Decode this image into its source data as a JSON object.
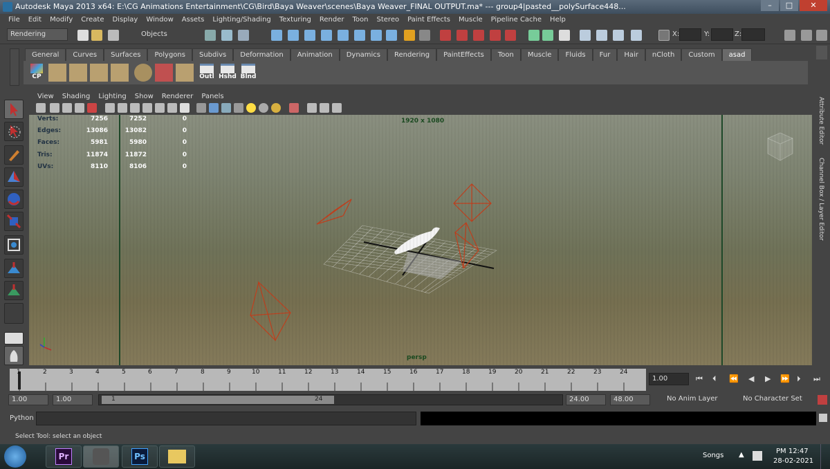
{
  "window": {
    "title": "Autodesk Maya 2013 x64: E:\\CG Animations Entertainment\\CG\\Bird\\Baya Weaver\\scenes\\Baya Weaver_FINAL OUTPUT.ma*   ---   group4|pasted__polySurface448..."
  },
  "menu": [
    "File",
    "Edit",
    "Modify",
    "Create",
    "Display",
    "Window",
    "Assets",
    "Lighting/Shading",
    "Texturing",
    "Render",
    "Toon",
    "Stereo",
    "Paint Effects",
    "Muscle",
    "Pipeline Cache",
    "Help"
  ],
  "statusline": {
    "menuset": "Rendering",
    "selection_mode": "Objects",
    "x_label": "X:",
    "y_label": "Y:",
    "z_label": "Z:"
  },
  "shelf_tabs": [
    "General",
    "Curves",
    "Surfaces",
    "Polygons",
    "Subdivs",
    "Deformation",
    "Animation",
    "Dynamics",
    "Rendering",
    "PaintEffects",
    "Toon",
    "Muscle",
    "Fluids",
    "Fur",
    "Hair",
    "nCloth",
    "Custom",
    "asad"
  ],
  "shelf_labels": {
    "cp": "CP",
    "outl": "Outl",
    "hshd": "Hshd",
    "blnd": "Blnd"
  },
  "panel_menu": [
    "View",
    "Shading",
    "Lighting",
    "Show",
    "Renderer",
    "Panels"
  ],
  "hud": {
    "rows": [
      {
        "label": "Verts:",
        "a": "7256",
        "b": "7252",
        "c": "0"
      },
      {
        "label": "Edges:",
        "a": "13086",
        "b": "13082",
        "c": "0"
      },
      {
        "label": "Faces:",
        "a": "5981",
        "b": "5980",
        "c": "0"
      },
      {
        "label": "Tris:",
        "a": "11874",
        "b": "11872",
        "c": "0"
      },
      {
        "label": "UVs:",
        "a": "8110",
        "b": "8106",
        "c": "0"
      }
    ],
    "resolution": "1920 x 1080",
    "camera": "persp"
  },
  "side_tabs": {
    "attribute_editor": "Attribute Editor",
    "channel_box": "Channel Box / Layer Editor"
  },
  "timeline": {
    "ticks": [
      "1",
      "2",
      "3",
      "4",
      "5",
      "6",
      "7",
      "8",
      "9",
      "10",
      "11",
      "12",
      "13",
      "14",
      "15",
      "16",
      "17",
      "18",
      "19",
      "20",
      "21",
      "22",
      "23",
      "24"
    ],
    "current_time": "1.00"
  },
  "range": {
    "start": "1.00",
    "playback_start": "1.00",
    "slider_start": "1",
    "slider_end": "24",
    "playback_end": "24.00",
    "end": "48.00",
    "anim_layer": "No Anim Layer",
    "character_set": "No Character Set"
  },
  "command": {
    "language": "Python"
  },
  "help_line": "Select Tool: select an object",
  "taskbar": {
    "tray_label": "Songs",
    "time": "PM 12:47",
    "date": "28-02-2021",
    "pr": "Pr",
    "ps": "Ps"
  }
}
